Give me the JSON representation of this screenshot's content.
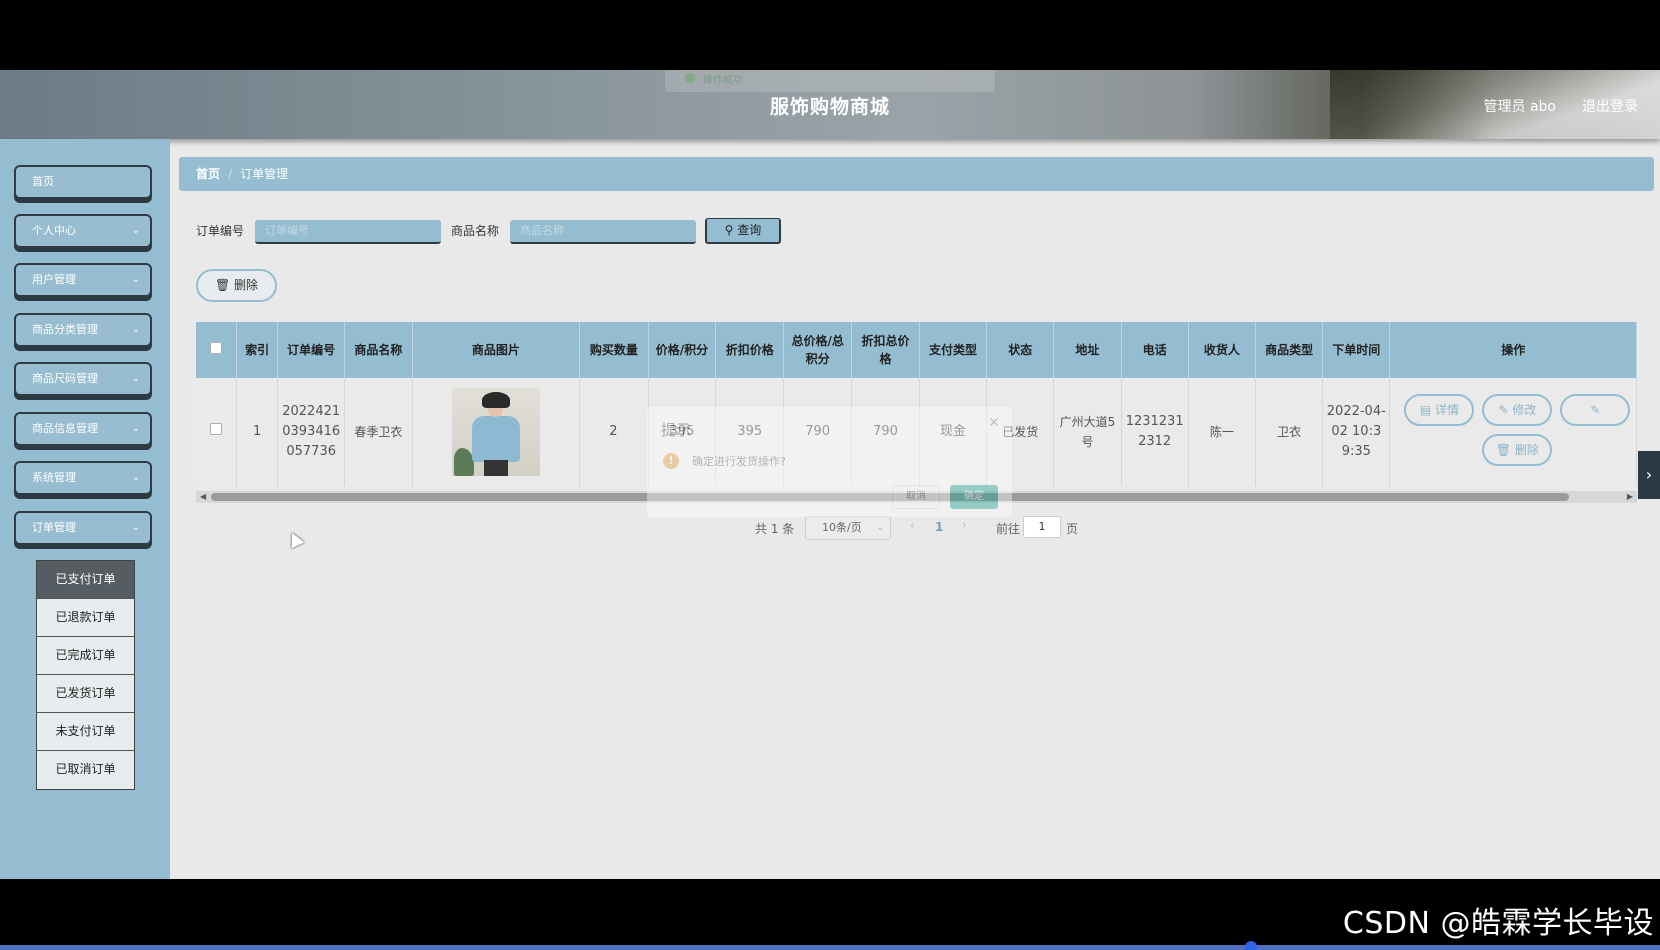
{
  "header": {
    "site_title": "服饰购物商城",
    "user_label": "管理员 abo",
    "logout_label": "退出登录",
    "toast_text": "操作成功"
  },
  "sidebar": {
    "items": [
      {
        "label": "首页",
        "has_chevron": false
      },
      {
        "label": "个人中心",
        "has_chevron": true
      },
      {
        "label": "用户管理",
        "has_chevron": true
      },
      {
        "label": "商品分类管理",
        "has_chevron": true
      },
      {
        "label": "商品尺码管理",
        "has_chevron": true
      },
      {
        "label": "商品信息管理",
        "has_chevron": true
      },
      {
        "label": "系统管理",
        "has_chevron": true
      },
      {
        "label": "订单管理",
        "has_chevron": true
      }
    ],
    "submenu": [
      "已支付订单",
      "已退款订单",
      "已完成订单",
      "已发货订单",
      "未支付订单",
      "已取消订单"
    ],
    "active_submenu": "已支付订单"
  },
  "breadcrumb": {
    "home": "首页",
    "current": "订单管理"
  },
  "search": {
    "order_no_label": "订单编号",
    "order_no_placeholder": "订单编号",
    "product_name_label": "商品名称",
    "product_name_placeholder": "商品名称",
    "query_label": "查询",
    "delete_label": "删除"
  },
  "table": {
    "columns": [
      "索引",
      "订单编号",
      "商品名称",
      "商品图片",
      "购买数量",
      "价格/积分",
      "折扣价格",
      "总价格/总积分",
      "折扣总价格",
      "支付类型",
      "状态",
      "地址",
      "电话",
      "收货人",
      "商品类型",
      "下单时间",
      "操作"
    ],
    "rows": [
      {
        "index": "1",
        "order_no": "20224210393416057736",
        "product_name": "春季卫衣",
        "image": "hoodie-photo",
        "quantity": "2",
        "price": "395",
        "discount_price": "395",
        "total_price": "790",
        "discount_total": "790",
        "pay_type": "现金",
        "status": "已发货",
        "address": "广州大道5号",
        "phone": "12312312312",
        "receiver": "陈一",
        "product_type": "卫衣",
        "order_time": "2022-04-02 10:39:35"
      }
    ],
    "actions": {
      "detail": "详情",
      "edit": "修改",
      "delete": "删除"
    }
  },
  "pagination": {
    "total": "共 1 条",
    "page_size": "10条/页",
    "current_page": "1",
    "goto_label": "前往",
    "goto_value": "1",
    "page_suffix": "页"
  },
  "dialog": {
    "title": "提示",
    "message": "确定进行发货操作?",
    "cancel": "取消",
    "ok": "确定"
  },
  "watermark": "CSDN @皓霖学长毕设",
  "colors": {
    "accent": "#95bdd1",
    "dark": "#2f3b44",
    "ok_button": "#1aa391",
    "warning": "#e6a23c"
  }
}
